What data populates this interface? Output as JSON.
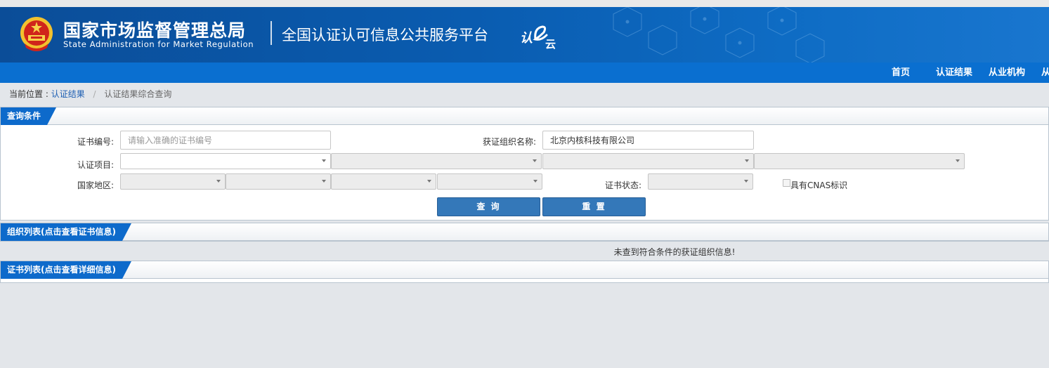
{
  "header": {
    "org_name_cn": "国家市场监督管理总局",
    "org_name_en": "State Administration  for  Market Regulation",
    "platform_title": "全国认证认可信息公共服务平台",
    "logo_text": "认e云",
    "emblem_icon": "national-emblem-icon",
    "brand_color": "#0a5cb0"
  },
  "nav": {
    "items": [
      "首页",
      "认证结果",
      "从业机构",
      "从"
    ]
  },
  "breadcrumb": {
    "prefix": "当前位置 :",
    "link": "认证结果",
    "separator": "/",
    "current": "认证结果综合查询"
  },
  "query": {
    "title": "查询条件",
    "cert_no_label": "证书编号:",
    "cert_no_placeholder": "请输入准确的证书编号",
    "cert_no_value": "",
    "org_name_label": "获证组织名称:",
    "org_name_value": "北京内核科技有限公司",
    "project_label": "认证项目:",
    "region_label": "国家地区:",
    "status_label": "证书状态:",
    "cnas_label": "具有CNAS标识",
    "cnas_checked": false,
    "search_button": "查 询",
    "reset_button": "重 置"
  },
  "org_list": {
    "title": "组织列表(点击查看证书信息)",
    "empty_message": "未查到符合条件的获证组织信息!"
  },
  "cert_list": {
    "title": "证书列表(点击查看详细信息)"
  }
}
